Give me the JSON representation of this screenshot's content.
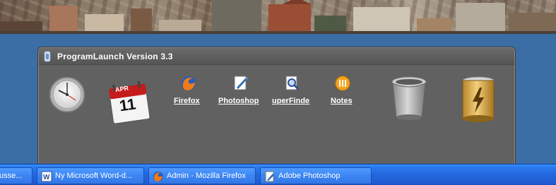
{
  "launcher": {
    "title": "ProgramLaunch Version 3.3",
    "clock_icon": "analog-clock-icon",
    "calendar": {
      "month": "APR",
      "day": "11"
    },
    "apps": [
      {
        "label": "Firefox",
        "icon": "firefox-icon"
      },
      {
        "label": "Photoshop",
        "icon": "photoshop-icon"
      },
      {
        "label": "uperFinde",
        "icon": "superfinder-icon"
      },
      {
        "label": "Notes",
        "icon": "notes-icon"
      }
    ],
    "trash_icon": "trash-can-icon",
    "battery_icon": "battery-charging-icon"
  },
  "taskbar": {
    "buttons": [
      {
        "label": "usse...",
        "icon": ""
      },
      {
        "label": "Ny Microsoft Word-d...",
        "icon": "word-icon"
      },
      {
        "label": "Admin - Mozilla Firefox",
        "icon": "firefox-icon"
      },
      {
        "label": "Adobe Photoshop",
        "icon": "photoshop-icon"
      }
    ]
  },
  "colors": {
    "desktop": "#3a6ea5",
    "launcher_bg": "#616161",
    "taskbar": "#2466dc"
  }
}
